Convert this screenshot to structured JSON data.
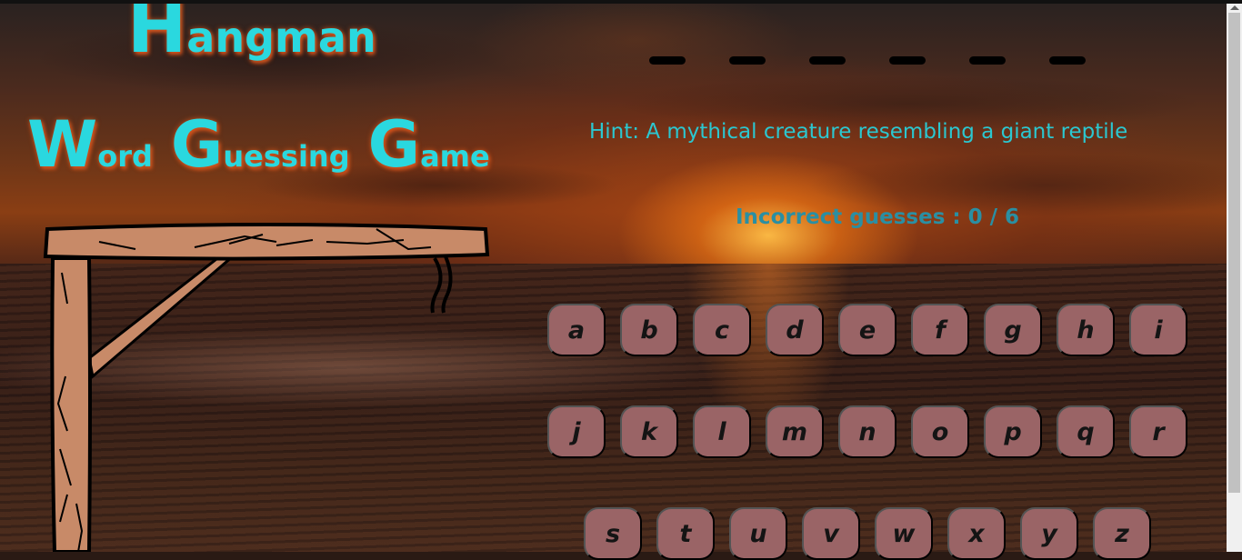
{
  "title": {
    "line1_initial": "H",
    "line1_rest": "angman",
    "line2": [
      {
        "initial": "W",
        "rest": "ord"
      },
      {
        "initial": "G",
        "rest": "uessing"
      },
      {
        "initial": "G",
        "rest": "ame"
      }
    ]
  },
  "word": {
    "length": 6
  },
  "hint": "Hint: A mythical creature resembling a giant reptile",
  "incorrect": {
    "text": "Incorrect guesses : 0 / 6",
    "count": 0,
    "max": 6
  },
  "keyboard": {
    "row1": [
      "a",
      "b",
      "c",
      "d",
      "e",
      "f",
      "g",
      "h",
      "i"
    ],
    "row2": [
      "j",
      "k",
      "l",
      "m",
      "n",
      "o",
      "p",
      "q",
      "r"
    ],
    "row3": [
      "s",
      "t",
      "u",
      "v",
      "w",
      "x",
      "y",
      "z"
    ]
  },
  "colors": {
    "title": "#2ad8df",
    "title_glow": "#d2521c",
    "hint": "#2bc7d0",
    "guesses": "#2a8fa3",
    "key_bg": "#9a6466",
    "wood": "#c88a68"
  }
}
